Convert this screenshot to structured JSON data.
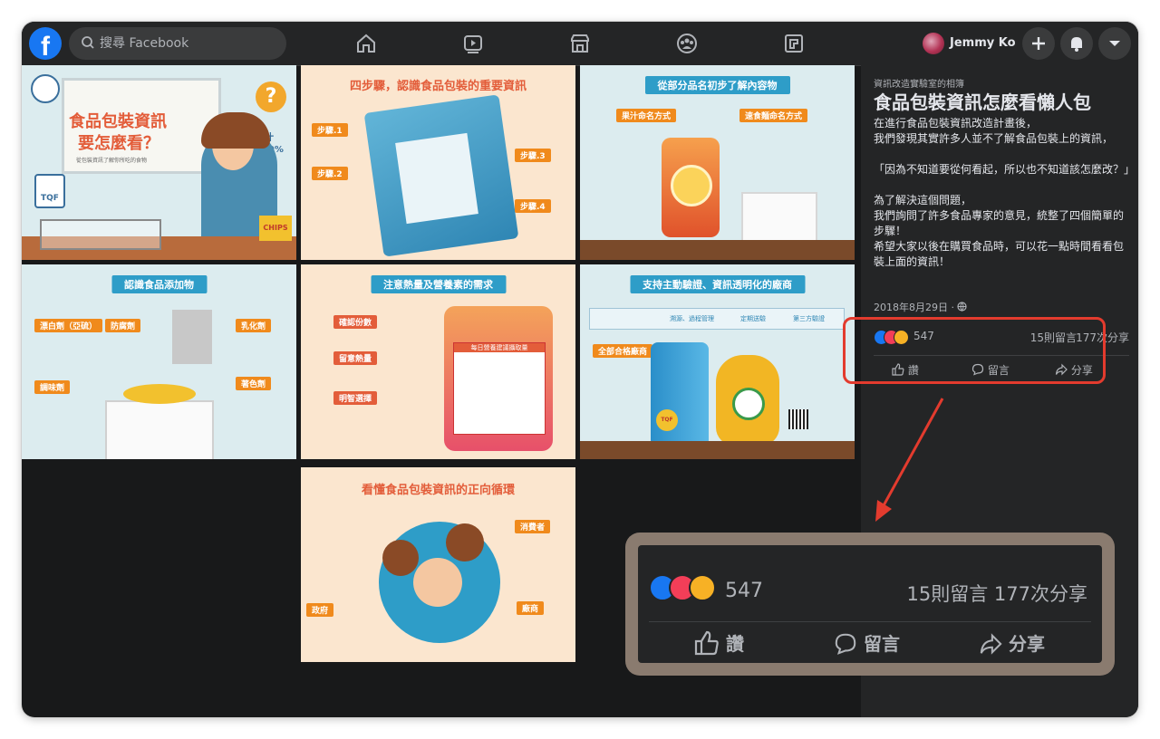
{
  "app": {
    "search_placeholder": "搜尋 Facebook",
    "user_name": "Jemmy Ko"
  },
  "tiles": {
    "t1": {
      "line1": "食品包裝資訊",
      "line2": "要怎麼看？",
      "badge": "果汁\n100%",
      "logo": "TQF",
      "chips": "CHIPS",
      "sub": "從包裝資訊了解你所吃的食物"
    },
    "t2": {
      "title": "四步驟，認識食品包裝的重要資訊",
      "steps": [
        "步驟.1",
        "步驟.2",
        "步驟.3",
        "步驟.4"
      ]
    },
    "t3": {
      "title": "從部分品名初步了解內容物",
      "left_tag": "果汁命名方式",
      "right_tag": "速食麵命名方式"
    },
    "t4": {
      "title": "認識食品添加物",
      "tags": [
        "漂白劑（亞硫）",
        "防腐劑",
        "乳化劑",
        "調味劑",
        "著色劑"
      ]
    },
    "t5": {
      "title": "注意熱量及營養素的需求",
      "tags": [
        "確認份數",
        "留意熱量",
        "明智選擇"
      ],
      "label_head": "每日營養建議攝取量"
    },
    "t6": {
      "title": "支持主動驗證、資訊透明化的廠商",
      "tag": "全部合格廠商",
      "checks": [
        "溯源、過程管理",
        "定期送驗",
        "第三方驗證"
      ],
      "logo": "TQF"
    },
    "t7": {
      "title": "看懂食品包裝資訊的正向循環",
      "tag_consumer": "消費者",
      "tag_gov": "政府",
      "tag_maker": "廠商"
    }
  },
  "post": {
    "source": "資訊改造實驗室的相簿",
    "title": "食品包裝資訊怎麼看懶人包",
    "paragraphs": [
      "在進行食品包裝資訊改造計畫後，",
      "我們發現其實許多人並不了解食品包裝上的資訊，",
      "",
      "「因為不知道要從何看起，所以也不知道該怎麼改？」",
      "",
      "為了解決這個問題，",
      "我們詢問了許多食品專家的意見，統整了四個簡單的步驟！",
      "希望大家以後在購買食品時，可以花一點時間看看包裝上面的資訊！"
    ],
    "date": "2018年8月29日 ·",
    "reactions": {
      "count": "547",
      "comments": "15則留言",
      "shares": "177次分享"
    },
    "actions": {
      "like": "讚",
      "comment": "留言",
      "share": "分享"
    }
  },
  "colors": {
    "facebook_blue": "#1877f2",
    "highlight_red": "#e33b2e",
    "like_blue": "#1877f2",
    "love_red": "#f33e58",
    "haha_yellow": "#f7b125"
  },
  "icons": [
    "facebook-logo-icon",
    "search-icon",
    "home-icon",
    "watch-icon",
    "marketplace-icon",
    "groups-icon",
    "gaming-icon",
    "plus-icon",
    "notifications-icon",
    "dropdown-icon",
    "like-icon",
    "comment-icon",
    "share-icon",
    "globe-icon"
  ]
}
